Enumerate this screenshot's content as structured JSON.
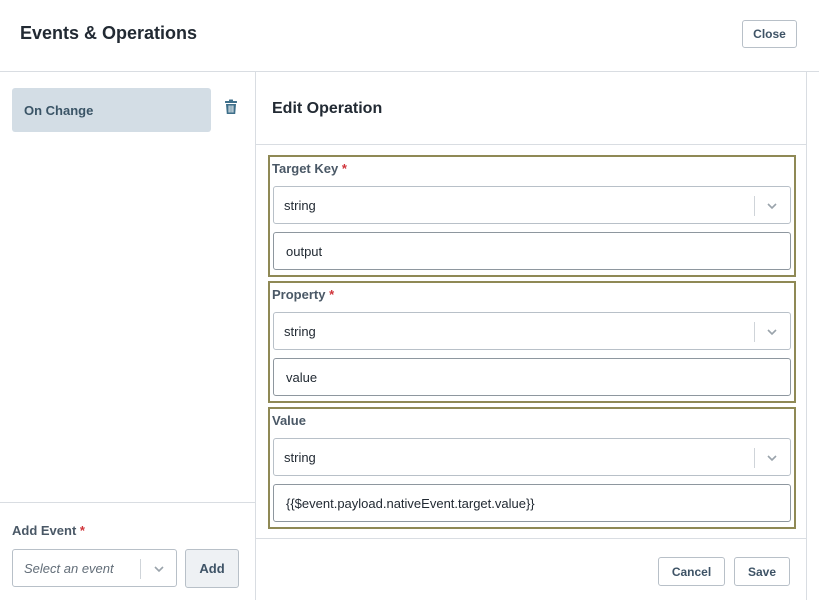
{
  "header": {
    "title": "Events & Operations",
    "close_label": "Close"
  },
  "sidebar": {
    "events": [
      {
        "label": "On Change"
      }
    ],
    "add_event": {
      "label": "Add Event",
      "required_mark": "*",
      "placeholder": "Select an event",
      "add_label": "Add"
    }
  },
  "editor": {
    "title": "Edit Operation",
    "fields": [
      {
        "label": "Target Key",
        "required_mark": "*",
        "type": "string",
        "value": "output"
      },
      {
        "label": "Property",
        "required_mark": "*",
        "type": "string",
        "value": "value"
      },
      {
        "label": "Value",
        "required_mark": "",
        "type": "string",
        "value": "{{$event.payload.nativeEvent.target.value}}"
      }
    ],
    "cancel_label": "Cancel",
    "save_label": "Save"
  },
  "icons": {
    "delete": "trash-icon",
    "dropdown": "chevron-down-icon"
  },
  "colors": {
    "selected_event_bg": "#d3dde5",
    "required": "#d0343a",
    "group_border": "#8f8955"
  }
}
